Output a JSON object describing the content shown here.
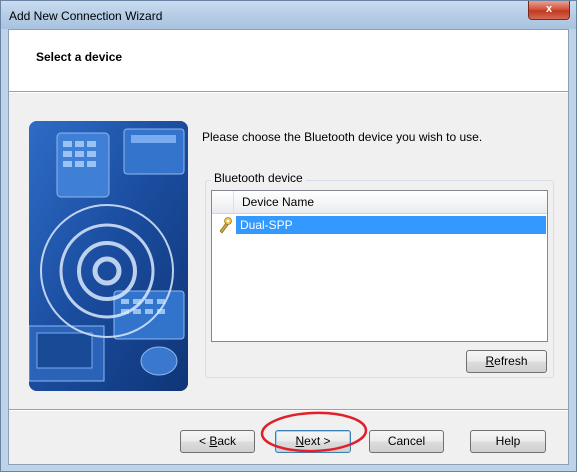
{
  "window": {
    "title": "Add New Connection Wizard",
    "close_glyph": "x"
  },
  "header": {
    "title": "Select a device"
  },
  "instruction": "Please choose the Bluetooth device you wish to use.",
  "group": {
    "legend": "Bluetooth device",
    "column_header": "Device Name",
    "devices": [
      {
        "name": "Dual-SPP",
        "selected": true,
        "icon": "bluetooth-device-icon"
      }
    ]
  },
  "buttons": {
    "refresh": {
      "prefix": "",
      "mnemonic": "R",
      "rest": "efresh"
    },
    "back": {
      "prefix": "< ",
      "mnemonic": "B",
      "rest": "ack"
    },
    "next": {
      "prefix": "",
      "mnemonic": "N",
      "rest": "ext >"
    },
    "cancel": "Cancel",
    "help": "Help"
  },
  "colors": {
    "selection": "#3399ff",
    "annotation": "#e0202a",
    "illustration": "#1b4fa0"
  }
}
